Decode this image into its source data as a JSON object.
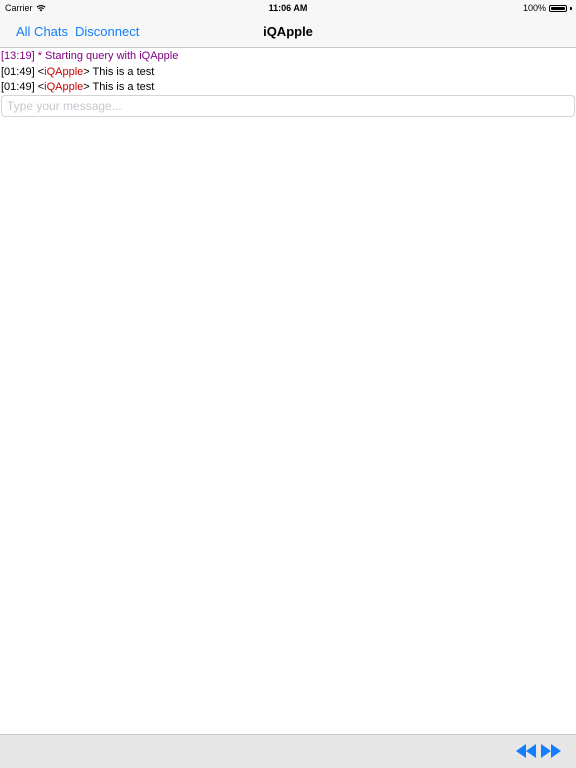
{
  "status_bar": {
    "carrier": "Carrier",
    "time": "11:06 AM",
    "battery": "100%"
  },
  "nav": {
    "all_chats": "All Chats",
    "disconnect": "Disconnect",
    "title": "iQApple"
  },
  "messages": [
    {
      "text": "[13:19] * Starting query with iQApple"
    },
    {
      "time": "[01:49]",
      "open": " <",
      "nick": "iQApple",
      "close": ">",
      "body": " This is a test"
    },
    {
      "time": "[01:49]",
      "open": " <",
      "nick": "iQApple",
      "close": ">",
      "body": " This is a test"
    }
  ],
  "input": {
    "placeholder": "Type your message..."
  },
  "colors": {
    "accent": "#147efb",
    "system_message": "#800080",
    "nick": "#cc0000",
    "toolbar_icon": "#147efb"
  },
  "toolbar": {
    "icons": [
      "rewind-icon",
      "fast-forward-icon"
    ]
  }
}
